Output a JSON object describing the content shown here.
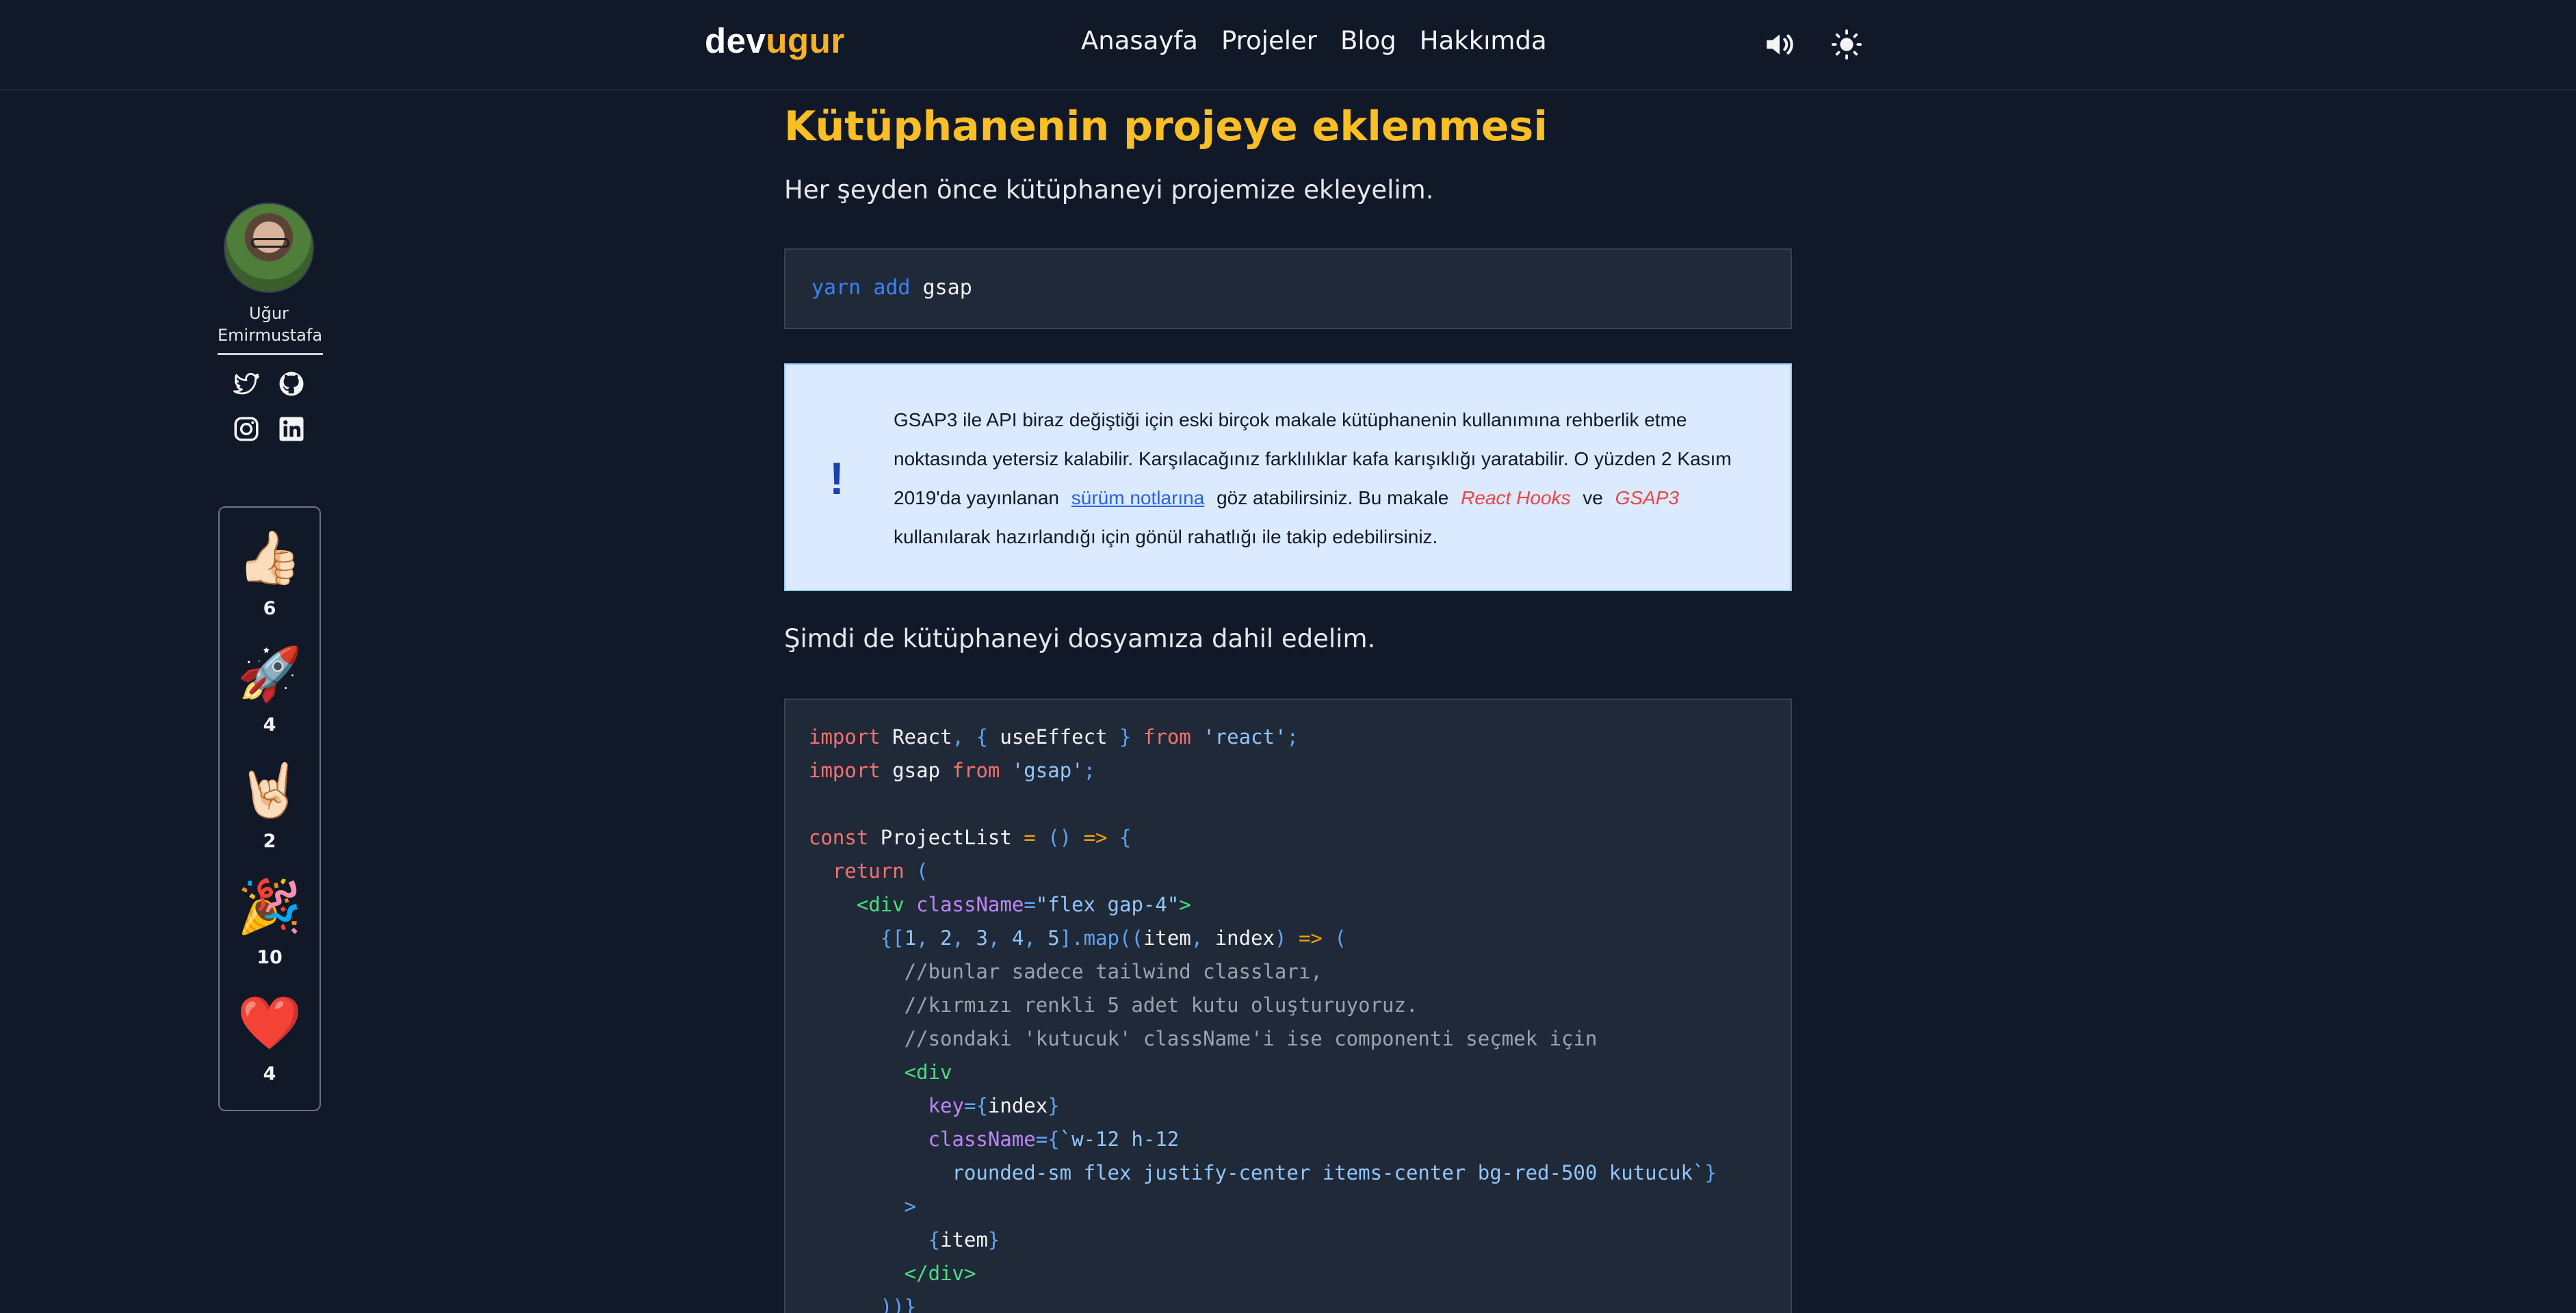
{
  "header": {
    "logo_main": "dev",
    "logo_accent": "ugur",
    "nav": [
      "Anasayfa",
      "Projeler",
      "Blog",
      "Hakkımda"
    ],
    "icons": [
      "speaker-icon",
      "sun-icon"
    ]
  },
  "sidebar": {
    "author_first": "Uğur",
    "author_last": "Emirmustafa",
    "socials": [
      "twitter-icon",
      "github-icon",
      "instagram-icon",
      "linkedin-icon"
    ],
    "reactions": [
      {
        "emoji": "👍🏻",
        "icon": "thumbs-up-icon",
        "count": "6"
      },
      {
        "emoji": "🚀",
        "icon": "rocket-icon",
        "count": "4"
      },
      {
        "emoji": "🤘🏻",
        "icon": "rock-hand-icon",
        "count": "2"
      },
      {
        "emoji": "🎉",
        "icon": "party-popper-icon",
        "count": "10"
      },
      {
        "emoji": "❤️",
        "icon": "heart-icon",
        "count": "4"
      }
    ]
  },
  "article": {
    "heading": "Kütüphanenin projeye eklenmesi",
    "intro": "Her şeyden önce kütüphaneyi projemize ekleyelim.",
    "install_cmd": {
      "yarn": "yarn",
      "add": "add",
      "pkg": "gsap"
    },
    "callout": {
      "mark": "!",
      "text_1": "GSAP3 ile API biraz değiştiği için eski birçok makale kütüphanenin kullanımına rehberlik etme noktasında yetersiz kalabilir. Karşılacağınız farklılıklar kafa karışıklığı yaratabilir. O yüzden 2 Kasım 2019'da yayınlanan",
      "link": "sürüm notlarına",
      "text_2": "göz atabilirsiniz. Bu makale",
      "em_1": "React Hooks",
      "text_3": "ve",
      "em_2": "GSAP3",
      "text_4": "kullanılarak hazırlandığı için gönül rahatlığı ile takip edebilirsiniz."
    },
    "para2": "Şimdi de kütüphaneyi dosyamıza dahil edelim.",
    "code": {
      "l1": {
        "a": "import",
        "b": " React",
        "c": ",",
        "d": " {",
        "e": " useEffect",
        "f": " }",
        "g": " from",
        "h": " 'react'",
        "i": ";"
      },
      "l2": {
        "a": "import",
        "b": " gsap",
        "c": " from",
        "d": " 'gsap'",
        "e": ";"
      },
      "l4": {
        "a": "const",
        "b": " ProjectList",
        "c": " =",
        "d": " ()",
        "e": " =>",
        "f": " {"
      },
      "l5": {
        "a": "  return",
        "b": " ("
      },
      "l6": {
        "a": "    <",
        "b": "div",
        "c": " className",
        "d": "=",
        "e": "\"flex gap-4\"",
        "f": ">"
      },
      "l7": {
        "a": "      {[",
        "b": "1",
        "c": ", ",
        "d": "2",
        "e": ", ",
        "f": "3",
        "g": ", ",
        "h": "4",
        "i": ", ",
        "j": "5",
        "k": "].",
        "l": "map",
        "m": "((",
        "n": "item",
        "o": ", ",
        "p": "index",
        "q": ")",
        "r": " =>",
        "s": " ("
      },
      "l8": "        //bunlar sadece tailwind classları,",
      "l9": "        //kırmızı renkli 5 adet kutu oluşturuyoruz.",
      "l10": "        //sondaki 'kutucuk' className'i ise componenti seçmek için",
      "l11": {
        "a": "        <",
        "b": "div"
      },
      "l12": {
        "a": "          key",
        "b": "={",
        "c": "index",
        "d": "}"
      },
      "l13": {
        "a": "          className",
        "b": "={",
        "c": "`w-12 h-12"
      },
      "l14": {
        "a": "            rounded-sm flex justify-center items-center bg-red-500 kutucuk`",
        "b": "}"
      },
      "l15": "        >",
      "l16": {
        "a": "          {",
        "b": "item",
        "c": "}"
      },
      "l17": {
        "a": "        </",
        "b": "div",
        "c": ">"
      },
      "l18": "      ))}"
    }
  }
}
